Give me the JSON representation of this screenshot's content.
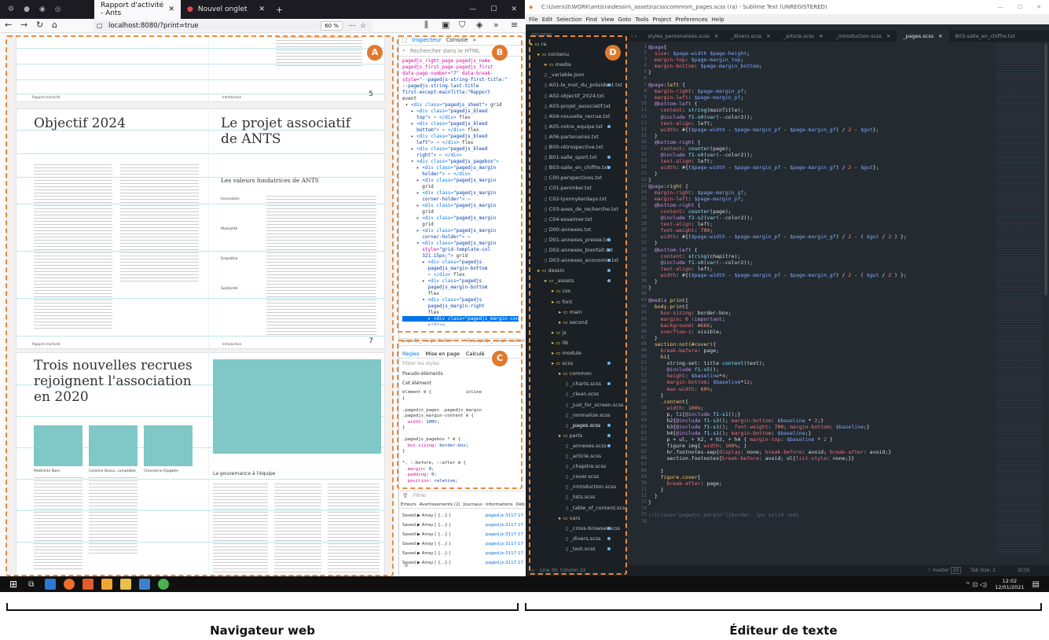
{
  "browser": {
    "tabs": [
      {
        "label": "Rapport d'activité - Ants",
        "active": true
      },
      {
        "label": "Nouvel onglet",
        "active": false
      }
    ],
    "new_tab_icon": "plus-icon",
    "url": "localhost:8080/?print=true",
    "zoom": "60 %",
    "devtools": {
      "tabs": [
        "Inspecteur",
        "Console"
      ],
      "search_placeholder": "Rechercher dans le HTML",
      "breadcrumb": "pagedjs_margin-bottom-... > div.pagedjs_margin-content",
      "rules_tabs": [
        "Règles",
        "Mise en page",
        "Calculé"
      ],
      "filter_placeholder": "Filtrer les styles",
      "pseudo": "Pseudo-éléments",
      "this_element": "Cet élément",
      "console_tabs": [
        "Erreurs",
        "Avertissements (2)",
        "Journaux",
        "Informations",
        "Déb"
      ],
      "console_filter": "Filtrer",
      "log_row": "Saved  ▶ Array [ {…} ]",
      "log_src": "paged.js:3117:17"
    }
  },
  "document": {
    "page5_number": "5",
    "page7_number": "7",
    "footer_left": "Rapport d'activité",
    "footer_mid": "Introduction",
    "heading_objectif": "Objectif 2024",
    "heading_projet": "Le projet associatif de ANTS",
    "subheading_valeurs": "Les valeurs fondatrices de ANTS",
    "heading_recrues": "Trois nouvelles recrues rejoignent l'association en 2020",
    "subheading_gouvernance": "La gouvernance à l'équipe",
    "names": [
      "Matthilde Baes",
      "Caroline Bossu, comptable",
      "Chloestine Djagbée"
    ],
    "values_terms": [
      "Innovation",
      "Mutualité",
      "Empathie",
      "Solidarité"
    ]
  },
  "editor": {
    "title": "C:\\Users\\lt\\WORK\\ants\\ra\\dessin\\_assets\\scss\\common\\_pages.scss (ra) - Sublime Text (UNREGISTERED)",
    "menu": [
      "File",
      "Edit",
      "Selection",
      "Find",
      "View",
      "Goto",
      "Tools",
      "Project",
      "Preferences",
      "Help"
    ],
    "folders_label": "FOLDERS",
    "tabs": [
      "styles_personalisés.scss",
      "_divers.scss",
      "_article.scss",
      "_introduction.scss",
      "_pages.scss",
      "B03-salle_en_chiffre.txt"
    ],
    "active_tab": "_pages.scss",
    "tree": [
      {
        "label": "ra",
        "type": "folder",
        "depth": 0
      },
      {
        "label": "contenu",
        "type": "folder",
        "depth": 1
      },
      {
        "label": "media",
        "type": "folder",
        "depth": 2
      },
      {
        "label": "_variable.json",
        "type": "file",
        "depth": 2
      },
      {
        "label": "A01-le_mot_du_président.txt",
        "type": "file",
        "depth": 2
      },
      {
        "label": "A02-objectif_2024.txt",
        "type": "file",
        "depth": 2
      },
      {
        "label": "A03-projet_associatif.txt",
        "type": "file",
        "depth": 2
      },
      {
        "label": "A04-nouvelle_recrue.txt",
        "type": "file",
        "depth": 2
      },
      {
        "label": "A05-notre_equipe.txt",
        "type": "file",
        "depth": 2
      },
      {
        "label": "A06-partenaires.txt",
        "type": "file",
        "depth": 2
      },
      {
        "label": "B00-rétrospective.txt",
        "type": "file",
        "depth": 2
      },
      {
        "label": "B01-salle_sport.txt",
        "type": "file",
        "depth": 2
      },
      {
        "label": "B03-salle_en_chiffre.txt",
        "type": "file",
        "depth": 2
      },
      {
        "label": "C00-perspectives.txt",
        "type": "file",
        "depth": 2
      },
      {
        "label": "C01-penmker.txt",
        "type": "file",
        "depth": 2
      },
      {
        "label": "C02-lyonnykerdays.txt",
        "type": "file",
        "depth": 2
      },
      {
        "label": "C03-axes_de_recherche.txt",
        "type": "file",
        "depth": 2
      },
      {
        "label": "C04-essaimer.txt",
        "type": "file",
        "depth": 2
      },
      {
        "label": "D00-annexes.txt",
        "type": "file",
        "depth": 2
      },
      {
        "label": "D01-annexes_presse.txt",
        "type": "file",
        "depth": 2
      },
      {
        "label": "D02-annexes_bienfait.txt",
        "type": "file",
        "depth": 2
      },
      {
        "label": "D03-annexes_economie.txt",
        "type": "file",
        "depth": 2
      },
      {
        "label": "dessin",
        "type": "folder",
        "depth": 1
      },
      {
        "label": "_assets",
        "type": "folder",
        "depth": 2
      },
      {
        "label": "css",
        "type": "folder",
        "depth": 3
      },
      {
        "label": "font",
        "type": "folder",
        "depth": 3
      },
      {
        "label": "main",
        "type": "folder",
        "depth": 4
      },
      {
        "label": "second",
        "type": "folder",
        "depth": 4
      },
      {
        "label": "js",
        "type": "folder",
        "depth": 3
      },
      {
        "label": "lib",
        "type": "folder",
        "depth": 3
      },
      {
        "label": "module",
        "type": "folder",
        "depth": 3
      },
      {
        "label": "scss",
        "type": "folder",
        "depth": 3
      },
      {
        "label": "common",
        "type": "folder",
        "depth": 4
      },
      {
        "label": "_charts.scss",
        "type": "file",
        "depth": 5
      },
      {
        "label": "_clean.scss",
        "type": "file",
        "depth": 5
      },
      {
        "label": "_just_for_screen.scss",
        "type": "file",
        "depth": 5
      },
      {
        "label": "_normalize.scss",
        "type": "file",
        "depth": 5
      },
      {
        "label": "_pages.scss",
        "type": "file",
        "depth": 5
      },
      {
        "label": "parts",
        "type": "folder",
        "depth": 4
      },
      {
        "label": "_annexes.scss",
        "type": "file",
        "depth": 5
      },
      {
        "label": "_article.scss",
        "type": "file",
        "depth": 5
      },
      {
        "label": "_chapitre.scss",
        "type": "file",
        "depth": 5
      },
      {
        "label": "_cover.scss",
        "type": "file",
        "depth": 5
      },
      {
        "label": "_introduction.scss",
        "type": "file",
        "depth": 5
      },
      {
        "label": "_lists.scss",
        "type": "file",
        "depth": 5
      },
      {
        "label": "_table_of_content.scss",
        "type": "file",
        "depth": 5
      },
      {
        "label": "vars",
        "type": "folder",
        "depth": 4
      },
      {
        "label": "_cross-browser.scss",
        "type": "file",
        "depth": 5
      },
      {
        "label": "_divers.scss",
        "type": "file",
        "depth": 5
      },
      {
        "label": "_text.scss",
        "type": "file",
        "depth": 5
      }
    ],
    "status_left": "Line 30, Column 22",
    "status_branch": "master",
    "status_branch_count": "20",
    "status_tab": "Tab Size: 2",
    "status_syntax": "SCSS"
  },
  "taskbar": {
    "time": "12:02",
    "date": "12/01/2021"
  },
  "callouts": [
    "A",
    "B",
    "C",
    "D"
  ],
  "captions": {
    "left": "Navigateur web",
    "right": "Éditeur de texte"
  },
  "colors": {
    "callout": "#e0792e",
    "editor_bg": "#232a30",
    "doc_teal": "#7fc8c7"
  }
}
